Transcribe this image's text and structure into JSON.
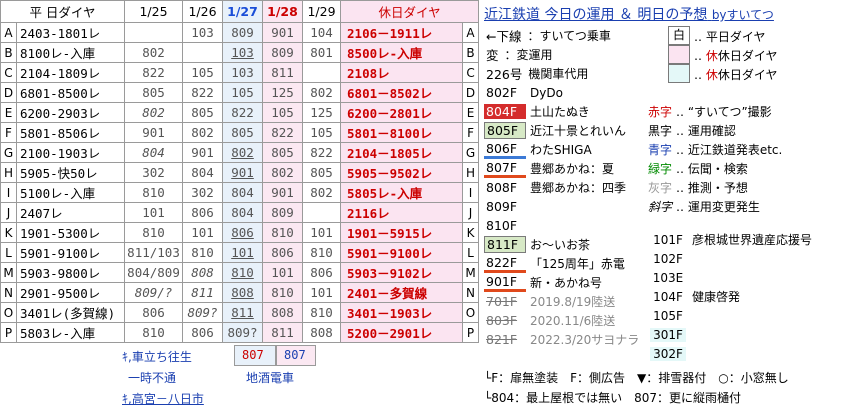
{
  "header": {
    "col_label": "平 日ダイヤ",
    "dates": [
      "1/25",
      "1/26",
      "1/27",
      "1/28",
      "1/29"
    ],
    "holiday_label": "休日ダイヤ"
  },
  "rows": [
    {
      "l": "A",
      "wk": "2403-1801レ",
      "v": [
        "",
        "103",
        "809",
        "901",
        "104"
      ],
      "hol": "2106－1911レ",
      "r": "A"
    },
    {
      "l": "B",
      "wk": "8100レ-入庫",
      "v": [
        "802",
        "",
        "103",
        "809",
        "801"
      ],
      "hol": "8500レ-入庫",
      "r": "B"
    },
    {
      "l": "C",
      "wk": "2104-1809レ",
      "v": [
        "822",
        "105",
        "103",
        "811",
        ""
      ],
      "hol": "2108レ",
      "r": "C"
    },
    {
      "l": "D",
      "wk": "6801-8500レ",
      "v": [
        "805",
        "822",
        "105",
        "125",
        "802"
      ],
      "hol": "6801－8502レ",
      "r": "D"
    },
    {
      "l": "E",
      "wk": "6200-2903レ",
      "v": [
        "802",
        "805",
        "822",
        "105",
        "125"
      ],
      "hol": "6200－2801レ",
      "r": "E"
    },
    {
      "l": "F",
      "wk": "5801-8506レ",
      "v": [
        "901",
        "802",
        "805",
        "822",
        "105"
      ],
      "hol": "5801－8100レ",
      "r": "F"
    },
    {
      "l": "G",
      "wk": "2100-1903レ",
      "v": [
        "804",
        "901",
        "802",
        "805",
        "822"
      ],
      "hol": "2104－1805レ",
      "r": "G"
    },
    {
      "l": "H",
      "wk": "5905-快50レ",
      "v": [
        "302",
        "804",
        "901",
        "802",
        "805"
      ],
      "hol": "5905－9502レ",
      "r": "H"
    },
    {
      "l": "I",
      "wk": "5100レ-入庫",
      "v": [
        "810",
        "302",
        "804",
        "901",
        "802"
      ],
      "hol": "5805レ-入庫",
      "r": "I"
    },
    {
      "l": "J",
      "wk": "2407レ",
      "v": [
        "101",
        "806",
        "804",
        "809",
        ""
      ],
      "hol": "2116レ",
      "r": "J"
    },
    {
      "l": "K",
      "wk": "1901-5300レ",
      "v": [
        "810",
        "101",
        "806",
        "810",
        "101"
      ],
      "hol": "1901－5915レ",
      "r": "K"
    },
    {
      "l": "L",
      "wk": "5901-9100レ",
      "v": [
        "811/103",
        "810",
        "101",
        "806",
        "810"
      ],
      "hol": "5901－9100レ",
      "r": "L"
    },
    {
      "l": "M",
      "wk": "5903-9800レ",
      "v": [
        "804/809",
        "808",
        "810",
        "101",
        "806"
      ],
      "hol": "5903－9102レ",
      "r": "M"
    },
    {
      "l": "N",
      "wk": "2901-9500レ",
      "v": [
        "809/?",
        "811",
        "808",
        "810",
        "101"
      ],
      "hol": "2401－多賀線",
      "r": "N"
    },
    {
      "l": "O",
      "wk": "3401レ(多賀線)",
      "v": [
        "806",
        "809?",
        "811",
        "808",
        "810"
      ],
      "hol": "3401－1903レ",
      "r": "O"
    },
    {
      "l": "P",
      "wk": "5803レ-入庫",
      "v": [
        "810",
        "806",
        "809?",
        "811",
        "808"
      ],
      "hol": "5200－2901レ",
      "r": "P"
    }
  ],
  "extra_row": {
    "label": "ｷ,車立ち往生",
    "v": [
      "807",
      "807"
    ]
  },
  "notes": {
    "ichiji": "一時不通",
    "jizake": "地酒電車",
    "takamiya": "ｷ,高宮－八日市"
  },
  "right": {
    "title": "近江鉄道 今日の運用 ＆ 明日の予想",
    "by": "byすいてつ",
    "items": [
      {
        "car": "←下線",
        "label": "：すいてつ乗車"
      },
      {
        "car": "変",
        "label": "：変運用"
      },
      {
        "car": "226号",
        "label": "機関車代用"
      },
      {
        "car": "802F",
        "label": "DyDo"
      },
      {
        "car": "804F",
        "label": "土山たぬき"
      },
      {
        "car": "805F",
        "label": "近江十景とれいん"
      },
      {
        "car": "806F",
        "label": "わたSHIGA"
      },
      {
        "car": "807F",
        "label": "豊郷あかね：夏"
      },
      {
        "car": "808F",
        "label": "豊郷あかね：四季"
      },
      {
        "car": "809F",
        "label": ""
      },
      {
        "car": "810F",
        "label": ""
      },
      {
        "car": "811F",
        "label": "お～いお茶"
      },
      {
        "car": "822F",
        "label": "「125周年」赤電"
      },
      {
        "car": "901F",
        "label": "新・あかね号"
      },
      {
        "car": "701F",
        "label": "2019.8/19陸送"
      },
      {
        "car": "803F",
        "label": "2020.11/6陸送"
      },
      {
        "car": "821F",
        "label": "2022.3/20サヨナラ"
      }
    ],
    "legend": [
      {
        "box": "白",
        "text": "平日ダイヤ"
      },
      {
        "box": "",
        "text": "休日ダイヤ"
      },
      {
        "box": "",
        "text": "休日ダイヤ"
      }
    ],
    "color_keys": [
      {
        "k": "赤字",
        "v": "“すいてつ”撮影"
      },
      {
        "k": "黒字",
        "v": "運用確認"
      },
      {
        "k": "青字",
        "v": "近江鉄道発表etc."
      },
      {
        "k": "緑字",
        "v": "伝聞・検索"
      },
      {
        "k": "灰字",
        "v": "推測・予想"
      },
      {
        "k": "斜字",
        "v": "運用変更発生"
      }
    ],
    "small_cars": [
      {
        "car": "101F",
        "label": "彦根城世界遺産応援号"
      },
      {
        "car": "102F",
        "label": ""
      },
      {
        "car": "103E",
        "label": ""
      },
      {
        "car": "104F",
        "label": "健康啓発"
      },
      {
        "car": "105F",
        "label": ""
      },
      {
        "car": "301F",
        "label": ""
      },
      {
        "car": "302F",
        "label": ""
      }
    ],
    "footer1": "└F：扉無塗装　F：側広告　▼：排雪器付　○：小窓無し",
    "footer2": "└804：最上屋根では無い　807：更に縦雨樋付"
  }
}
